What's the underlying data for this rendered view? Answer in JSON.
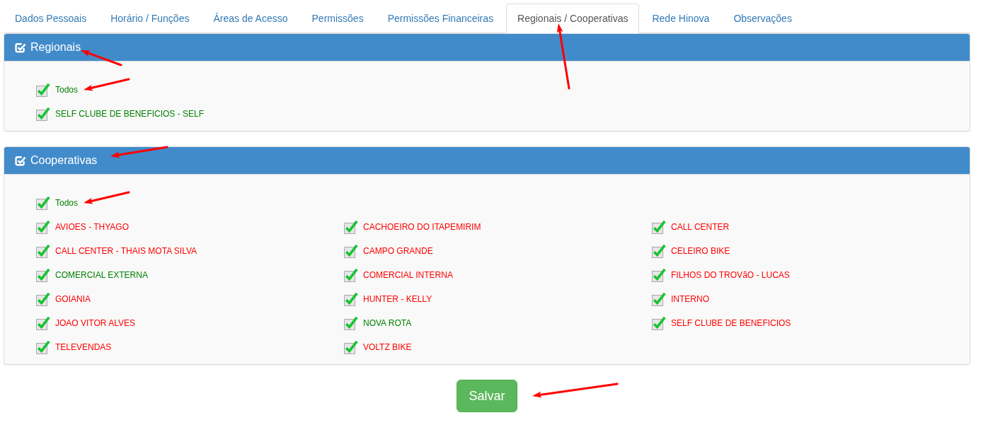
{
  "tabs": [
    {
      "label": "Dados Pessoais",
      "selected": false
    },
    {
      "label": "Horário / Funções",
      "selected": false
    },
    {
      "label": "Áreas de Acesso",
      "selected": false
    },
    {
      "label": "Permissões",
      "selected": false
    },
    {
      "label": "Permissões Financeiras",
      "selected": false
    },
    {
      "label": "Regionais / Cooperativas",
      "selected": true,
      "pointer_arrow": true
    },
    {
      "label": "Rede Hinova",
      "selected": false
    },
    {
      "label": "Observações",
      "selected": false
    }
  ],
  "panels": [
    {
      "title": "Regionais",
      "pointer_arrow": true,
      "arrow_from_above": false,
      "all_option": {
        "label": "Todos",
        "checked": true,
        "color": "#008000",
        "pointer_arrow": true
      },
      "items": [
        {
          "label": "SELF CLUBE DE BENEFICIOS - SELF",
          "checked": true,
          "color": "#008000"
        }
      ]
    },
    {
      "title": "Cooperativas",
      "pointer_arrow": true,
      "arrow_from_above": true,
      "all_option": {
        "label": "Todos",
        "checked": true,
        "color": "#008000",
        "pointer_arrow": true
      },
      "items": [
        {
          "label": "AVIOES - THYAGO",
          "checked": true,
          "color": "#ff0000"
        },
        {
          "label": "CACHOEIRO DO ITAPEMIRIM",
          "checked": true,
          "color": "#ff0000"
        },
        {
          "label": "CALL CENTER",
          "checked": true,
          "color": "#ff0000"
        },
        {
          "label": "CALL CENTER - THAIS MOTA SILVA",
          "checked": true,
          "color": "#ff0000"
        },
        {
          "label": "CAMPO GRANDE",
          "checked": true,
          "color": "#ff0000"
        },
        {
          "label": "CELEIRO BIKE",
          "checked": true,
          "color": "#ff0000"
        },
        {
          "label": "COMERCIAL EXTERNA",
          "checked": true,
          "color": "#008000"
        },
        {
          "label": "COMERCIAL INTERNA",
          "checked": true,
          "color": "#ff0000"
        },
        {
          "label": "FILHOS DO TROVãO - LUCAS",
          "checked": true,
          "color": "#ff0000"
        },
        {
          "label": "GOIANIA",
          "checked": true,
          "color": "#ff0000"
        },
        {
          "label": "HUNTER - KELLY",
          "checked": true,
          "color": "#ff0000"
        },
        {
          "label": "INTERNO",
          "checked": true,
          "color": "#ff0000"
        },
        {
          "label": "JOAO VITOR ALVES",
          "checked": true,
          "color": "#ff0000"
        },
        {
          "label": "NOVA ROTA",
          "checked": true,
          "color": "#008000"
        },
        {
          "label": "SELF CLUBE DE BENEFICIOS",
          "checked": true,
          "color": "#ff0000"
        },
        {
          "label": "TELEVENDAS",
          "checked": true,
          "color": "#ff0000"
        },
        {
          "label": "VOLTZ BIKE",
          "checked": true,
          "color": "#ff0000"
        }
      ]
    }
  ],
  "save_button": {
    "label": "Salvar",
    "pointer_arrow": true
  }
}
